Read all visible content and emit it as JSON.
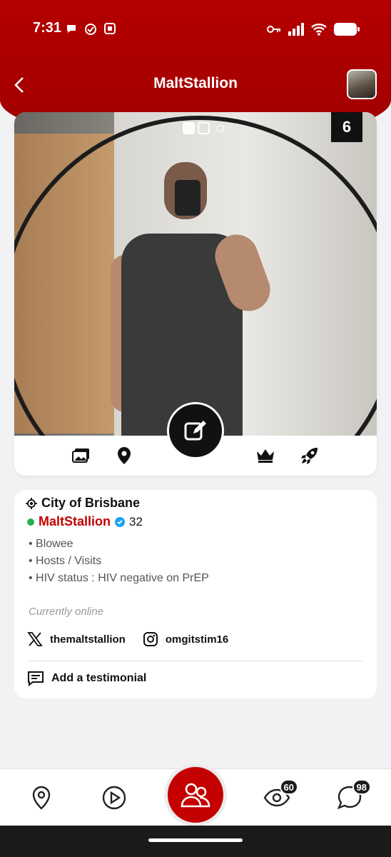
{
  "status_bar": {
    "time": "7:31",
    "left_icons": [
      "chat-bubble-icon",
      "check-circle-icon",
      "app-notification-icon"
    ],
    "right_icons": [
      "key-icon",
      "signal-icon",
      "wifi-icon",
      "battery-icon"
    ]
  },
  "header": {
    "title": "MaltStallion",
    "back_icon": "chevron-left-icon"
  },
  "photo": {
    "count": "6",
    "dots": 3,
    "active_dot": 0
  },
  "actions": {
    "icons": [
      "gallery-icon",
      "location-pin-icon",
      "edit-icon",
      "crown-icon",
      "rocket-icon"
    ]
  },
  "profile": {
    "location": "City of Brisbane",
    "name": "MaltStallion",
    "age": "32",
    "bullets": [
      "• Blowee",
      "• Hosts / Visits",
      "• HIV status : HIV negative on PrEP"
    ],
    "online_status": "Currently online",
    "twitter": "themaltstallion",
    "instagram": "omgitstim16",
    "testimonial_label": "Add a testimonial"
  },
  "bottom_nav": {
    "items": [
      "map-pin-icon",
      "play-icon",
      "people-icon",
      "eye-icon",
      "chat-icon"
    ],
    "views_badge": "60",
    "messages_badge": "98"
  },
  "colors": {
    "brand_red": "#c00000",
    "online_green": "#22b14c",
    "verified_blue": "#1da1f2"
  }
}
